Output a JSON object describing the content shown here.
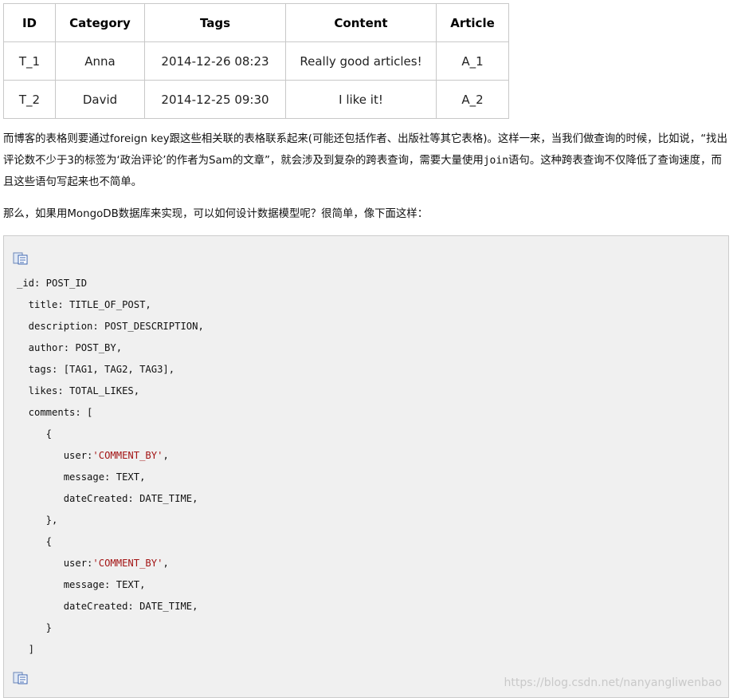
{
  "table": {
    "headers": [
      "ID",
      "Category",
      "Tags",
      "Content",
      "Article"
    ],
    "rows": [
      [
        "T_1",
        "Anna",
        "2014-12-26 08:23",
        "Really good articles!",
        "A_1"
      ],
      [
        "T_2",
        "David",
        "2014-12-25 09:30",
        "I like it!",
        "A_2"
      ]
    ]
  },
  "para1": {
    "a": "而博客的表格则要通过foreign key跟这些相关联的表格联系起来(可能还包括作者、出版社等其它表格)。这样一来，当我们做查询的时候，比如说，“找出评论数不少于3的标签为‘政治评论’的作者为Sam的文章”，就会涉及到复杂的跨表查询，需要大量使用",
    "code": "join",
    "b": "语句。这种跨表查询不仅降低了查询速度，而且这些语句写起来也不简单。"
  },
  "para2": "那么，如果用MongoDB数据库来实现，可以如何设计数据模型呢？很简单，像下面这样：",
  "code": {
    "l1": "_id: POST_ID",
    "l2": "  title: TITLE_OF_POST,",
    "l3": "  description: POST_DESCRIPTION,",
    "l4": "  author: POST_BY,",
    "l5": "  tags: [TAG1, TAG2, TAG3],",
    "l6": "  likes: TOTAL_LIKES,",
    "l7": "  comments: [",
    "l8": "     {",
    "l9a": "        user:",
    "l9b": "'COMMENT_BY'",
    "l9c": ",",
    "l10": "        message: TEXT,",
    "l11": "        dateCreated: DATE_TIME,",
    "l12": "     },",
    "l13": "     {",
    "l14a": "        user:",
    "l14b": "'COMMENT_BY'",
    "l14c": ",",
    "l15": "        message: TEXT,",
    "l16": "        dateCreated: DATE_TIME,",
    "l17": "     }",
    "l18": "  ]"
  },
  "icons": {
    "copy": "copy-icon"
  },
  "watermark": "https://blog.csdn.net/nanyangliwenbao"
}
